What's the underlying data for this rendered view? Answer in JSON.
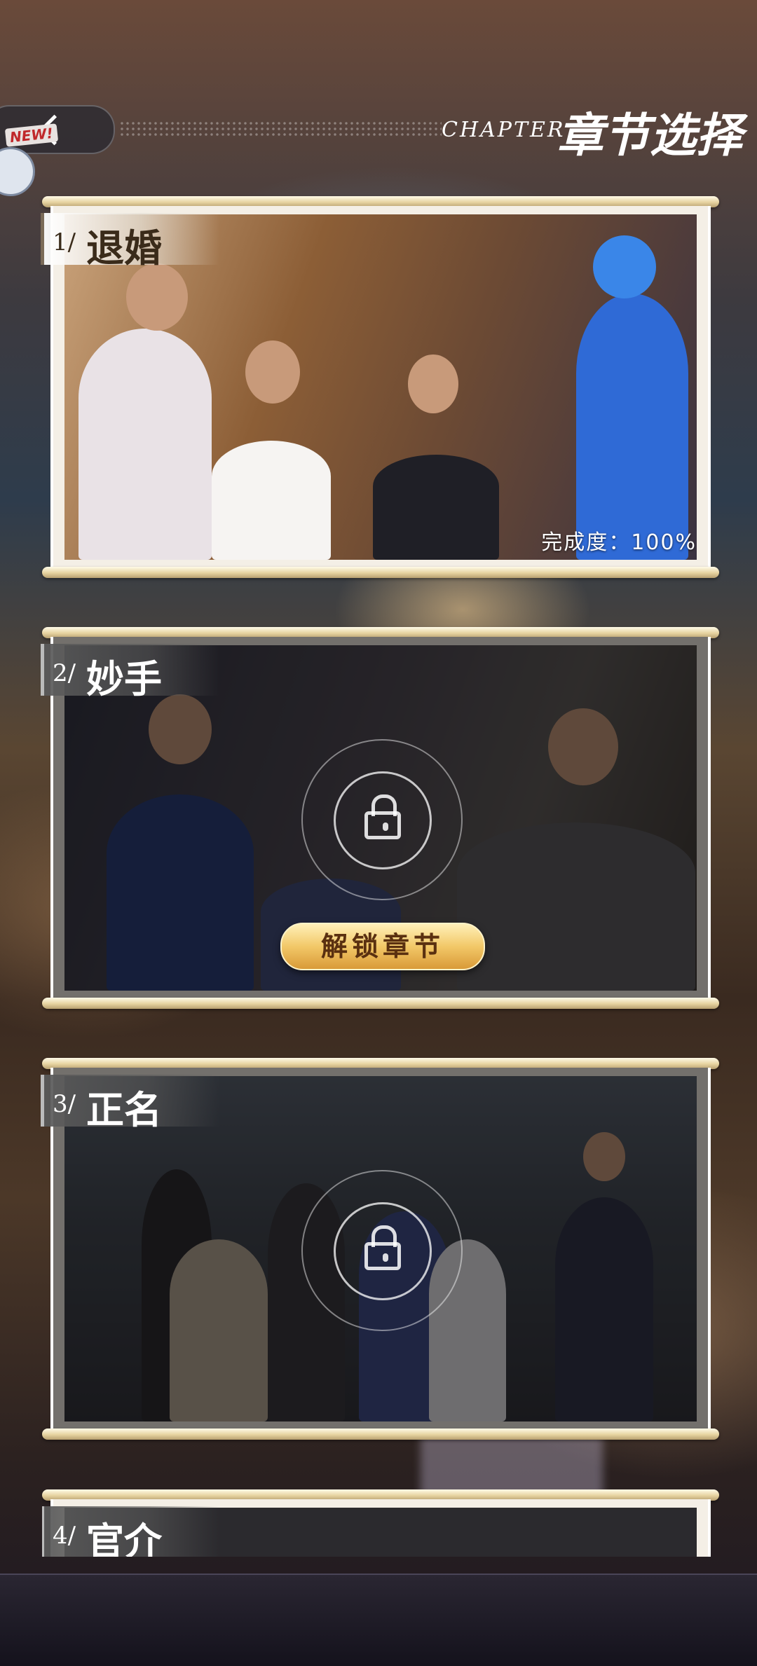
{
  "header": {
    "back_label": "",
    "new_badge": "NEW!",
    "chapter_en": "CHAPTER",
    "chapter_zh": "章节选择"
  },
  "chapters": [
    {
      "num": "1/",
      "name": "退婚",
      "completion": "完成度：100%",
      "locked": false
    },
    {
      "num": "2/",
      "name": "妙手",
      "unlock_label": "解锁章节",
      "locked": true
    },
    {
      "num": "3/",
      "name": "正名",
      "locked": true
    },
    {
      "num": "4/",
      "name": "官介",
      "locked": true
    }
  ],
  "colors": {
    "gold_button": "#f2c868",
    "rod": "#e6d3a0"
  }
}
